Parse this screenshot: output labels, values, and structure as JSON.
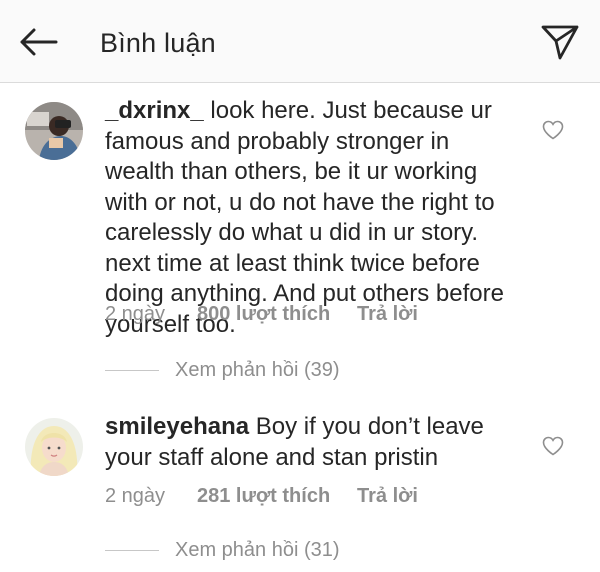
{
  "header": {
    "title": "Bình luận",
    "back_icon": "arrow-left-icon",
    "send_icon": "paper-plane-icon"
  },
  "comments": [
    {
      "username": "_dxrinx_",
      "text": "look here. Just because ur famous and probably stronger in wealth than others, be it ur working with or not, u do not have the right to carelessly do what u did in ur story. next time at least think twice before doing anything. And put others before yourself too.",
      "time": "2 ngày",
      "likes": "800 lượt thích",
      "reply_label": "Trả lời",
      "view_replies": "Xem phản hồi (39)",
      "like_icon": "heart-outline-icon"
    },
    {
      "username": "smileyehana",
      "text": "Boy if you don’t leave your staff alone and stan pristin",
      "time": "2 ngày",
      "likes": "281 lượt thích",
      "reply_label": "Trả lời",
      "view_replies": "Xem phản hồi (31)",
      "like_icon": "heart-outline-icon"
    }
  ],
  "colors": {
    "primary_text": "#262626",
    "secondary_text": "#8e8e8e",
    "header_bg": "#fafafa",
    "divider": "#dbdbdb"
  }
}
